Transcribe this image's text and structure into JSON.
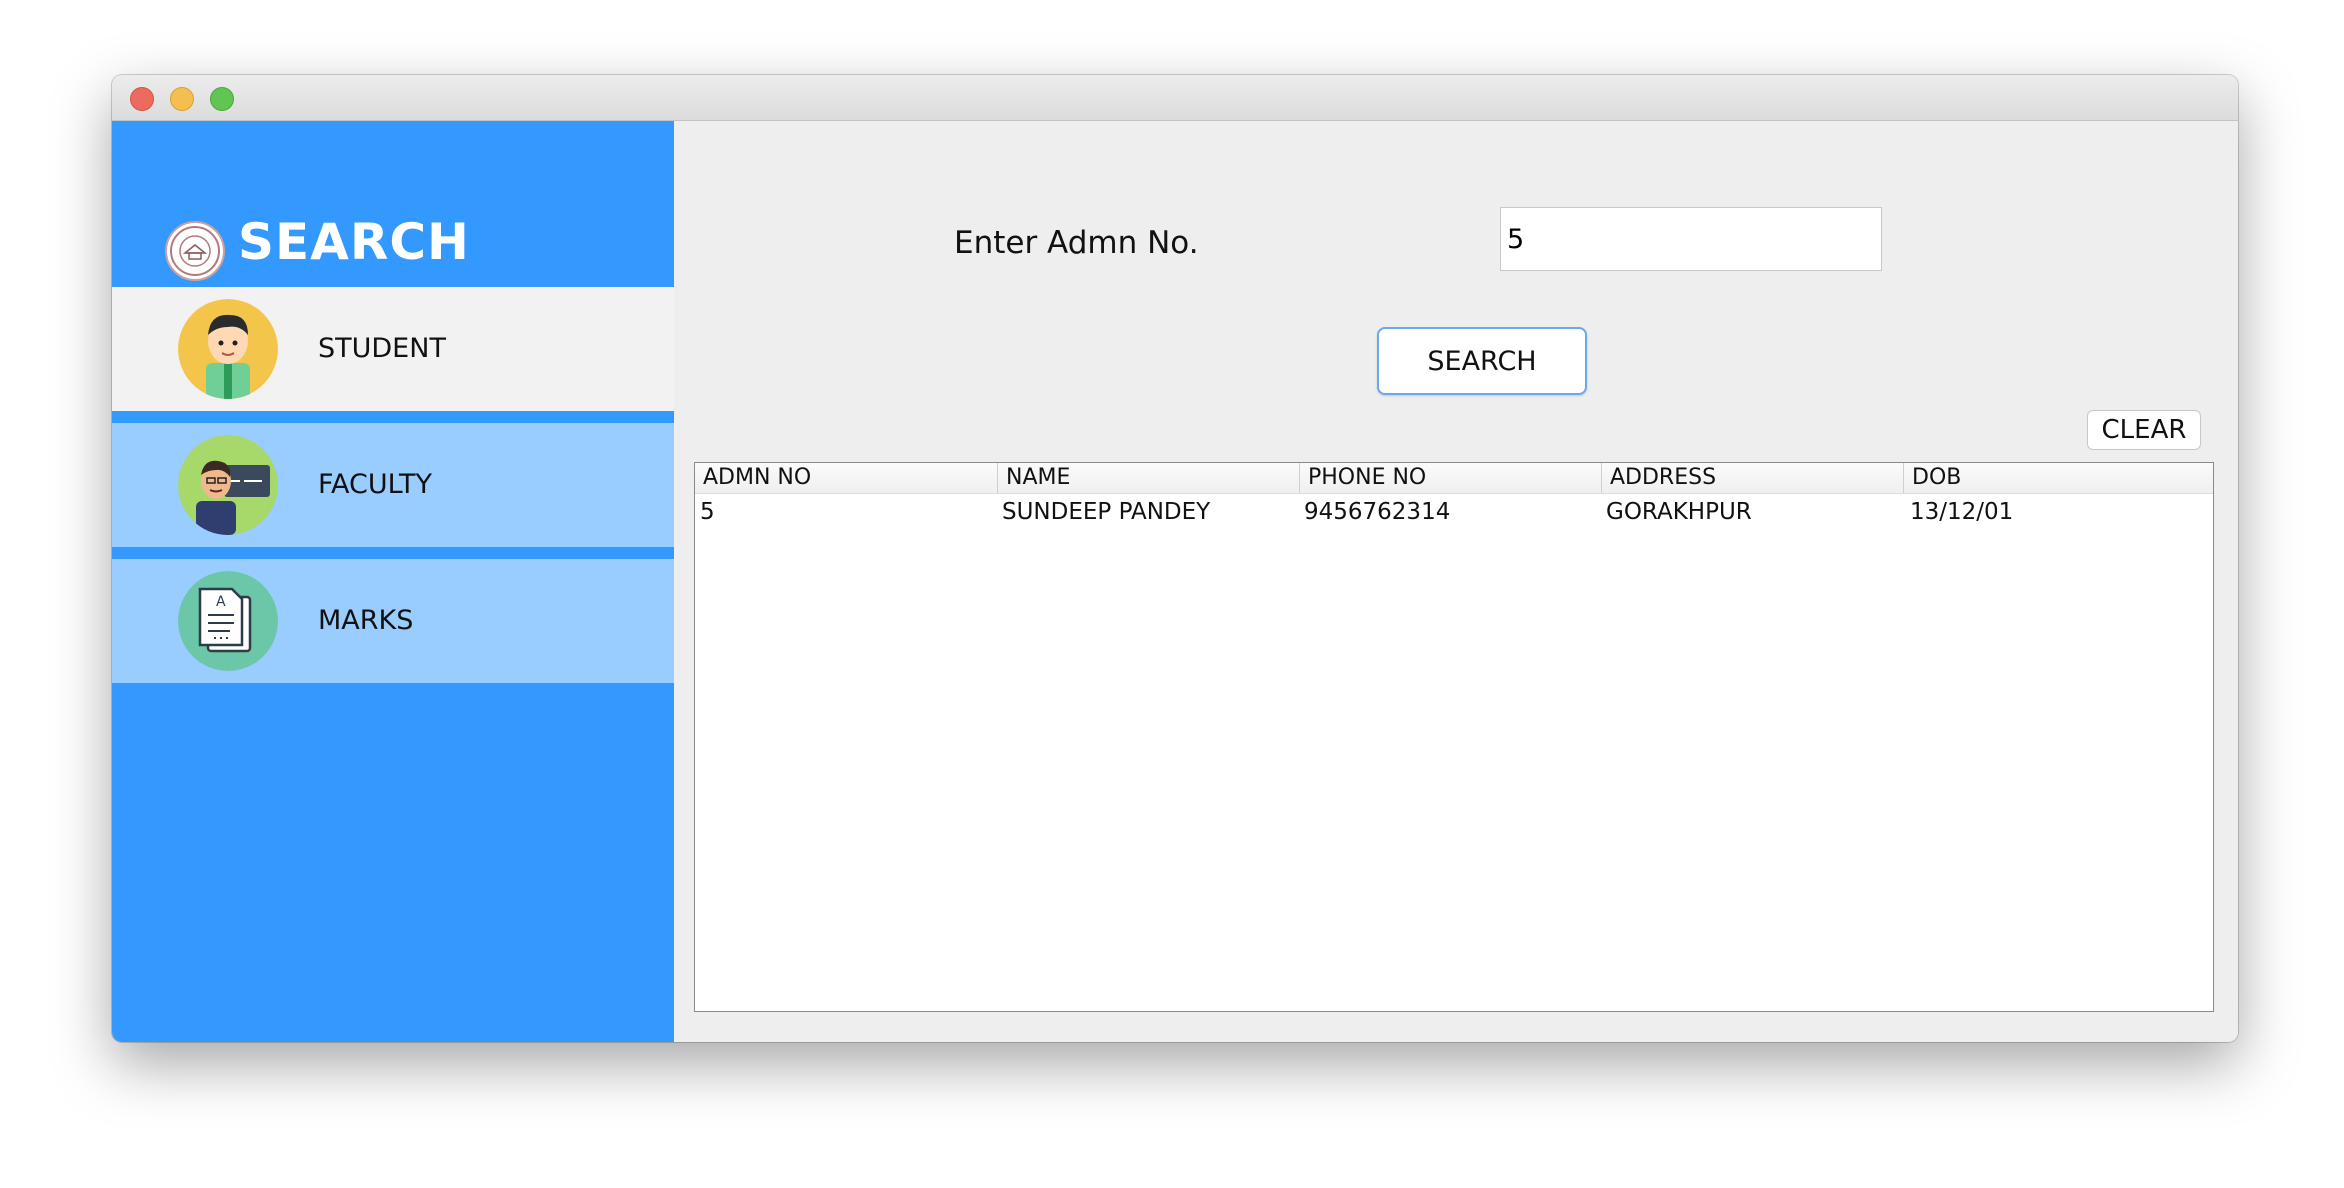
{
  "sidebar": {
    "title": "SEARCH",
    "items": [
      {
        "label": "STUDENT",
        "icon": "student-avatar-icon"
      },
      {
        "label": "FACULTY",
        "icon": "faculty-avatar-icon"
      },
      {
        "label": "MARKS",
        "icon": "document-icon"
      }
    ]
  },
  "form": {
    "admn_label": "Enter Admn No.",
    "admn_value": "5",
    "search_label": "SEARCH",
    "clear_label": "CLEAR"
  },
  "table": {
    "columns": [
      "ADMN NO",
      "NAME",
      "PHONE NO",
      "ADDRESS",
      "DOB"
    ],
    "rows": [
      [
        "5",
        "SUNDEEP PANDEY",
        "9456762314",
        "GORAKHPUR",
        "13/12/01"
      ]
    ]
  },
  "colors": {
    "sidebar": "#3399ff",
    "active_item": "#f2f2f2",
    "inactive_item": "#99ccff"
  }
}
